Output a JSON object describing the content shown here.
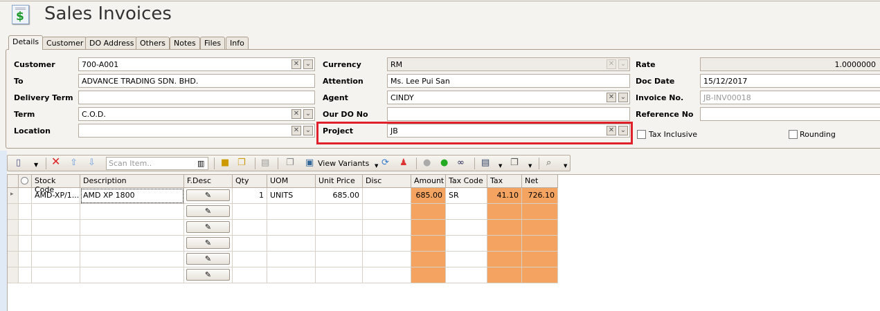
{
  "window": {
    "title": "Sales Invoices",
    "icon": "invoice-dollar-icon"
  },
  "tabs": [
    {
      "label": "Details",
      "active": true
    },
    {
      "label": "Customer"
    },
    {
      "label": "DO Address"
    },
    {
      "label": "Others"
    },
    {
      "label": "Notes"
    },
    {
      "label": "Files"
    },
    {
      "label": "Info"
    }
  ],
  "form": {
    "customer": {
      "label": "Customer",
      "value": "700-A001"
    },
    "to": {
      "label": "To",
      "value": "ADVANCE TRADING SDN. BHD."
    },
    "delivery_term": {
      "label": "Delivery Term",
      "value": ""
    },
    "term": {
      "label": "Term",
      "value": "C.O.D."
    },
    "location": {
      "label": "Location",
      "value": ""
    },
    "currency": {
      "label": "Currency",
      "value": "RM"
    },
    "attention": {
      "label": "Attention",
      "value": "Ms. Lee Pui San"
    },
    "agent": {
      "label": "Agent",
      "value": "CINDY"
    },
    "our_do_no": {
      "label": "Our DO No",
      "value": ""
    },
    "project": {
      "label": "Project",
      "value": "JB"
    },
    "rate": {
      "label": "Rate",
      "value": "1.0000000"
    },
    "doc_date": {
      "label": "Doc Date",
      "value": "15/12/2017"
    },
    "invoice_no": {
      "label": "Invoice No.",
      "value": "JB-INV00018"
    },
    "reference_no": {
      "label": "Reference No",
      "value": ""
    },
    "tax_inclusive": {
      "label": "Tax Inclusive",
      "checked": false
    },
    "rounding": {
      "label": "Rounding",
      "checked": false
    }
  },
  "toolbar": {
    "scan_placeholder": "Scan Item..",
    "view_variants": "View Variants"
  },
  "grid": {
    "columns": [
      "Stock Code",
      "Description",
      "F.Desc",
      "Qty",
      "UOM",
      "Unit Price",
      "Disc",
      "Amount",
      "Tax Code",
      "Tax",
      "Net"
    ],
    "rows": [
      {
        "stock_code": "AMD-XP/1...",
        "description": "AMD XP 1800",
        "qty": "1",
        "uom": "UNITS",
        "unit_price": "685.00",
        "disc": "",
        "amount": "685.00",
        "tax_code": "SR",
        "tax": "41.10",
        "net": "726.10"
      }
    ],
    "empty_rows": 5
  },
  "colors": {
    "highlight": "#e0202a",
    "computed_cell": "#f4a460"
  }
}
